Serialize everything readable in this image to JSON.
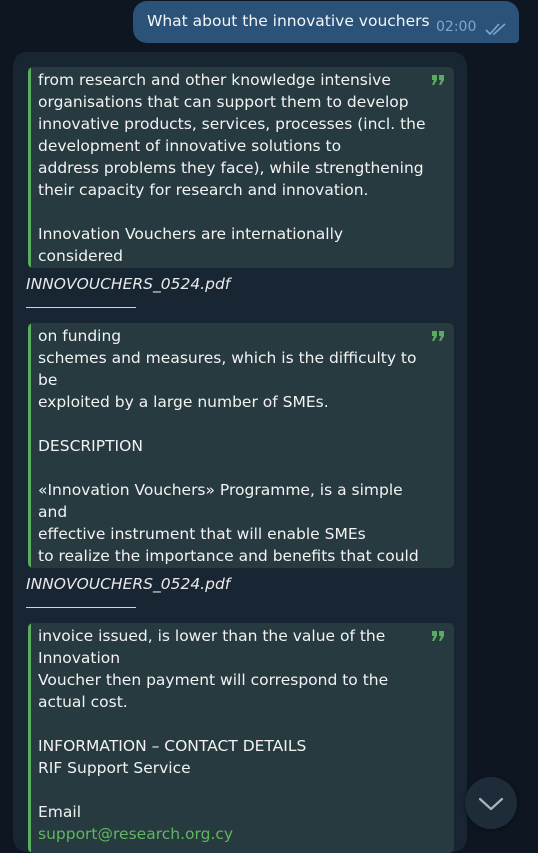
{
  "outgoing": {
    "text": "What about the innovative vouchers",
    "time": "02:00",
    "status_icon": "double-check-icon"
  },
  "incoming": {
    "quotes": [
      {
        "text": "from research and other knowledge intensive\norganisations that can support them to develop\ninnovative products, services, processes (incl. the\ndevelopment of innovative solutions to\naddress problems they face), while strengthening\ntheir capacity for research and innovation.\n\nInnovation Vouchers are internationally considered\nas one of the simpl...",
        "caption": "INNOVOUCHERS_0524.pdf"
      },
      {
        "text": "on funding\nschemes and measures, which is the difficulty to be\nexploited by a large number of SMEs.\n\nDESCRIPTION\n\n«Innovation Vouchers» Programme, is a simple and\neffective instrument that will enable SMEs\nto realize the importance and benefits that could\nemerge from their involvement in research\nand innovation activities and, through the re...",
        "caption": "INNOVOUCHERS_0524.pdf"
      },
      {
        "text": "invoice issued, is lower than the value of the\nInnovation\nVoucher then payment will correspond to the\nactual cost.\n\nINFORMATION – CONTACT DETAILS\nRIF Support Service\n\nEmail",
        "link": "support@research.org.cy"
      }
    ]
  },
  "colors": {
    "background": "#0e1621",
    "outgoing_bubble": "#2b5278",
    "incoming_bubble": "#182533",
    "quote_accent": "#5aad5e"
  },
  "icons": {
    "quote": "quote-icon",
    "scroll": "chevron-down-icon"
  }
}
